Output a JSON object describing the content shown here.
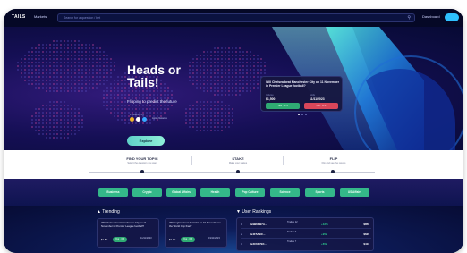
{
  "colors": {
    "accent": "#34b889",
    "navy": "#070c35",
    "yes": "#2faa73",
    "no": "#d9465a",
    "cyan": "#2ec0ff"
  },
  "topbar": {
    "logo": "TAILS",
    "nav_markets": "Markets",
    "search_placeholder": "Search for a question / bet",
    "nav_dashboard": "Dashboard",
    "search_icon": "search-icon"
  },
  "hero": {
    "title": "Heads or Tails!",
    "subtitle": "Flipping to predict the future",
    "powered_by": "Powered by",
    "partner_name": "Aptos Network",
    "explore": "Explore"
  },
  "featured": {
    "question": "Will Chelsea beat Manchester City on 11 November in Premier League football?",
    "volume_label": "Volume",
    "volume": "$1,500",
    "date_label": "Ends",
    "date": "11/11/2023",
    "yes": "Yes · 0.5",
    "no": "No · 0.5"
  },
  "steps": [
    {
      "title": "FIND YOUR TOPIC",
      "desc": "Select the question you want"
    },
    {
      "title": "STAKE",
      "desc": "Make your stakes"
    },
    {
      "title": "FLIP",
      "desc": "Flip and see the results"
    }
  ],
  "categories": [
    "Business",
    "Crypto",
    "Global Affairs",
    "Health",
    "Pop Culture",
    "Science",
    "Sports",
    "US Affairs"
  ],
  "trending": {
    "title": "Trending",
    "cards": [
      {
        "question": "Will Chelsea beat Manchester City on 11 November in Premier League football?",
        "volume": "$1.5K",
        "yes": "Yes · 0.5",
        "date": "11/11/2023"
      },
      {
        "question": "Will England beat Australia on 19 November in the World Cup final?",
        "volume": "$2.1K",
        "yes": "Yes · 0.5",
        "date": "19/11/2023"
      }
    ]
  },
  "rankings": {
    "title": "User Rankings",
    "rows": [
      {
        "num": "1",
        "name": "0x9B6DB7A...",
        "stat": "Trades 12",
        "value": "+12%",
        "amount": "$850"
      },
      {
        "num": "2",
        "name": "0x4F5ABC...",
        "stat": "Trades 9",
        "value": "+9%",
        "amount": "$620"
      },
      {
        "num": "3",
        "name": "0x3C6D7EF...",
        "stat": "Trades 7",
        "value": "+6%",
        "amount": "$410"
      }
    ]
  }
}
